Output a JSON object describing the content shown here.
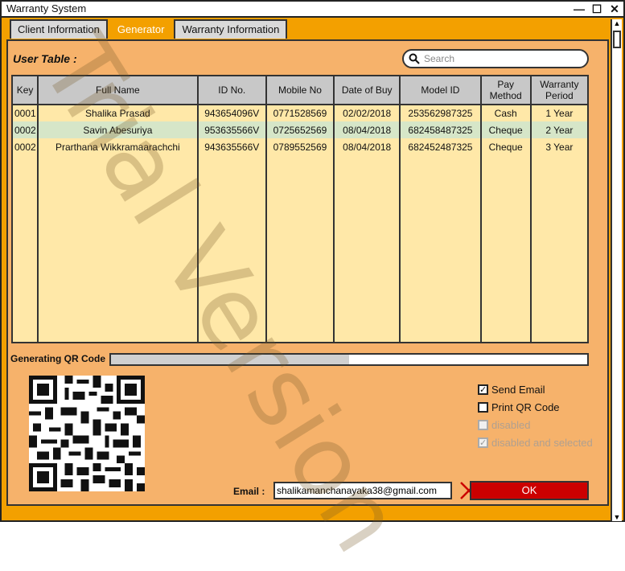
{
  "window": {
    "title": "Warranty System",
    "controls": [
      "—",
      "☐",
      "✕"
    ]
  },
  "tabs": [
    {
      "label": "Client Information",
      "active": false
    },
    {
      "label": "Generator",
      "active": true
    },
    {
      "label": "Warranty Information",
      "active": false
    }
  ],
  "user_table": {
    "label": "User Table :",
    "search_placeholder": "Search",
    "columns": [
      "Key",
      "Full Name",
      "ID No.",
      "Mobile No",
      "Date of Buy",
      "Model ID",
      "Pay Method",
      "Warranty Period"
    ],
    "rows": [
      {
        "key": "0001",
        "full_name": "Shalika Prasad",
        "id_no": "943654096V",
        "mobile": "0771528569",
        "date_of_buy": "02/02/2018",
        "model_id": "253562987325",
        "pay_method": "Cash",
        "warranty_period": "1 Year",
        "selected": false
      },
      {
        "key": "0002",
        "full_name": "Savin Abesuriya",
        "id_no": "953635566V",
        "mobile": "0725652569",
        "date_of_buy": "08/04/2018",
        "model_id": "682458487325",
        "pay_method": "Cheque",
        "warranty_period": "2 Year",
        "selected": true
      },
      {
        "key": "0002",
        "full_name": "Prarthana Wikkramaarachchi",
        "id_no": "943635566V",
        "mobile": "0789552569",
        "date_of_buy": "08/04/2018",
        "model_id": "682452487325",
        "pay_method": "Cheque",
        "warranty_period": "3 Year",
        "selected": false
      }
    ]
  },
  "qr": {
    "label": "Generating QR Code",
    "progress": 0.5
  },
  "options": [
    {
      "label": "Send Email",
      "checked": true,
      "disabled": false
    },
    {
      "label": "Print QR Code",
      "checked": false,
      "disabled": false
    },
    {
      "label": "disabled",
      "checked": false,
      "disabled": true
    },
    {
      "label": "disabled and selected",
      "checked": true,
      "disabled": true
    }
  ],
  "email": {
    "label": "Email :",
    "value": "shalikamanchanayaka38@gmail.com"
  },
  "ok_label": "OK",
  "watermark": "Trial Version",
  "colors": {
    "accent": "#f3a000",
    "panel": "#f6b26b",
    "table_bg": "#ffe8a8",
    "ok_button": "#cc0000"
  }
}
